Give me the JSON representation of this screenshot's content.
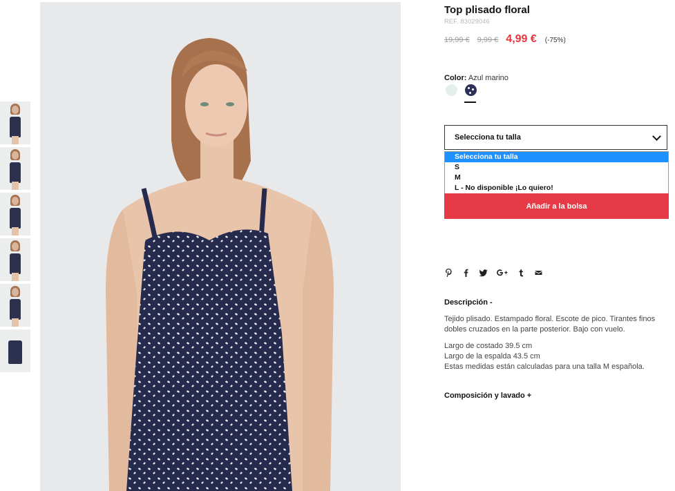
{
  "product": {
    "title": "Top plisado floral",
    "ref": "REF. 83029046",
    "old_price_1": "19,99 €",
    "old_price_2": "9,99 €",
    "price": "4,99 €",
    "discount": "(-75%)"
  },
  "color": {
    "label": "Color:",
    "value": "Azul marino",
    "swatches": [
      "#e3efec",
      "#2d3158"
    ],
    "selected_index": 1
  },
  "size": {
    "select_label": "Selecciona tu talla",
    "options": [
      "Selecciona tu talla",
      "S",
      "M",
      "L - No disponible ¡Lo quiero!"
    ],
    "highlighted_index": 0
  },
  "cart": {
    "add_label": "Añadir a la bolsa"
  },
  "share_icons": [
    "pinterest-icon",
    "facebook-icon",
    "twitter-icon",
    "google-plus-icon",
    "tumblr-icon",
    "email-icon"
  ],
  "description": {
    "heading": "Descripción -",
    "text": "Tejido plisado. Estampado floral. Escote de pico. Tirantes finos dobles cruzados en la parte posterior. Bajo con vuelo.",
    "measure_1": "Largo de costado 39.5 cm",
    "measure_2": "Largo de la espalda 43.5 cm",
    "measure_3": "Estas medidas están calculadas para una talla M española."
  },
  "composition": {
    "heading": "Composición y lavado +"
  },
  "colors": {
    "accent": "#e63a46",
    "price": "#e5343a",
    "highlight": "#1e90ff"
  }
}
